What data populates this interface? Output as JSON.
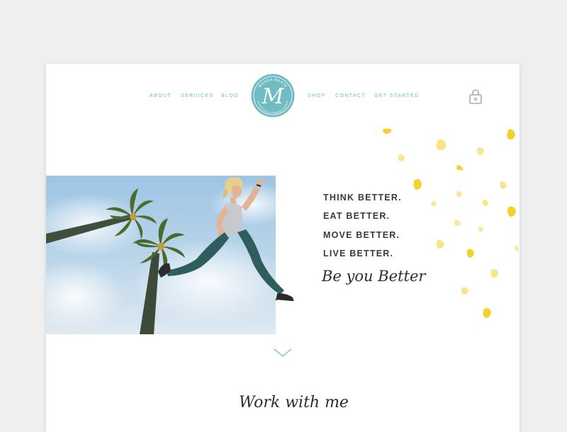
{
  "nav": {
    "left": [
      "ABOUT",
      "SERVICES",
      "BLOG"
    ],
    "right": [
      "SHOP",
      "CONTACT",
      "GET STARTED"
    ]
  },
  "logo": {
    "initial": "M",
    "top_text": "MANDA MAXIM",
    "bottom_text": "NUTRITION & FITNESS COACH"
  },
  "hero": {
    "tagline": [
      "THINK BETTER.",
      "EAT BETTER.",
      "MOVE BETTER.",
      "LIVE BETTER."
    ],
    "script": "Be you Better"
  },
  "section": {
    "title": "Work with me"
  },
  "colors": {
    "accent_teal": "#6fbcc2",
    "confetti_yellow": "#f3d22e",
    "text_dark": "#3a3a3a"
  },
  "icons": {
    "cart": "shopping-bag-icon",
    "scroll": "chevron-down-icon"
  }
}
